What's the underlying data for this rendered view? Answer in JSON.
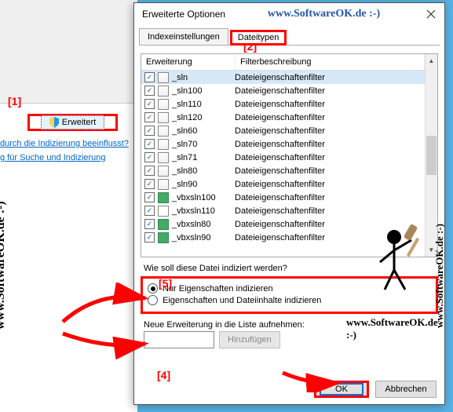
{
  "watermark": "www.SoftwareOK.de :-)",
  "left": {
    "erweitert": "Erweitert",
    "link1": "durch die Indizierung beeinflusst?",
    "link2": "g für Suche und Indizierung"
  },
  "dialog": {
    "title": "Erweiterte Optionen",
    "tabs": {
      "index": "Indexeinstellungen",
      "types": "Dateitypen"
    },
    "headers": {
      "ext": "Erweiterung",
      "filter": "Filterbeschreibung"
    },
    "rows": [
      {
        "ext": "_sln",
        "desc": "Dateieigenschaftenfilter",
        "sel": true,
        "icon": "sln"
      },
      {
        "ext": "_sln100",
        "desc": "Dateieigenschaftenfilter",
        "icon": "sln"
      },
      {
        "ext": "_sln110",
        "desc": "Dateieigenschaftenfilter",
        "icon": "sln"
      },
      {
        "ext": "_sln120",
        "desc": "Dateieigenschaftenfilter",
        "icon": "sln"
      },
      {
        "ext": "_sln60",
        "desc": "Dateieigenschaftenfilter",
        "icon": "sln"
      },
      {
        "ext": "_sln70",
        "desc": "Dateieigenschaftenfilter",
        "icon": "sln"
      },
      {
        "ext": "_sln71",
        "desc": "Dateieigenschaftenfilter",
        "icon": "sln"
      },
      {
        "ext": "_sln80",
        "desc": "Dateieigenschaftenfilter",
        "icon": "sln"
      },
      {
        "ext": "_sln90",
        "desc": "Dateieigenschaftenfilter",
        "icon": "sln"
      },
      {
        "ext": "_vbxsln100",
        "desc": "Dateieigenschaftenfilter",
        "icon": "vb"
      },
      {
        "ext": "_vbxsln110",
        "desc": "Dateieigenschaftenfilter",
        "icon": "doc"
      },
      {
        "ext": "_vbxsln80",
        "desc": "Dateieigenschaftenfilter",
        "icon": "vb"
      },
      {
        "ext": "_vbxsln90",
        "desc": "Dateieigenschaftenfilter",
        "icon": "vb"
      }
    ],
    "question": "Wie soll diese Datei indiziert werden?",
    "radio1": "Nur Eigenschaften indizieren",
    "radio2": "Eigenschaften und Dateiinhalte indizieren",
    "newext_label": "Neue Erweiterung in die Liste aufnehmen:",
    "addbtn": "Hinzufügen",
    "ok": "OK",
    "cancel": "Abbrechen"
  },
  "ann": {
    "a1": "[1]",
    "a2": "[2]",
    "a4": "[4]",
    "a5": "[5]"
  }
}
